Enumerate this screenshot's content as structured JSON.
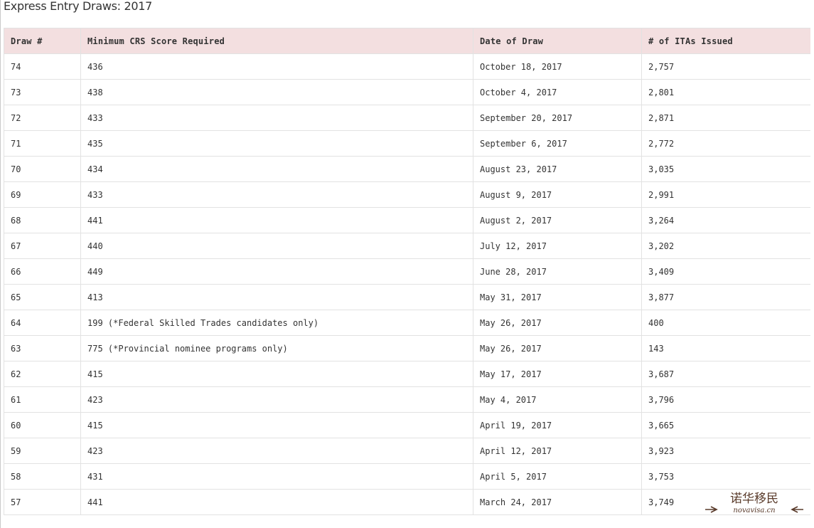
{
  "page": {
    "title": "Express Entry Draws: 2017"
  },
  "table": {
    "headers": [
      "Draw #",
      "Minimum CRS Score Required",
      "Date of Draw",
      "# of ITAs Issued"
    ],
    "rows": [
      [
        "74",
        "436",
        "October 18, 2017",
        "2,757"
      ],
      [
        "73",
        "438",
        "October 4, 2017",
        "2,801"
      ],
      [
        "72",
        "433",
        "September 20, 2017",
        "2,871"
      ],
      [
        "71",
        "435",
        "September 6, 2017",
        "2,772"
      ],
      [
        "70",
        "434",
        "August 23, 2017",
        "3,035"
      ],
      [
        "69",
        "433",
        "August 9, 2017",
        "2,991"
      ],
      [
        "68",
        "441",
        "August 2, 2017",
        "3,264"
      ],
      [
        "67",
        "440",
        "July 12, 2017",
        "3,202"
      ],
      [
        "66",
        "449",
        "June 28, 2017",
        "3,409"
      ],
      [
        "65",
        "413",
        "May 31, 2017",
        "3,877"
      ],
      [
        "64",
        "199 (*Federal Skilled Trades candidates only)",
        "May 26, 2017",
        "400"
      ],
      [
        "63",
        "775 (*Provincial nominee programs only)",
        "May 26, 2017",
        "143"
      ],
      [
        "62",
        "415",
        "May 17, 2017",
        "3,687"
      ],
      [
        "61",
        "423",
        "May 4, 2017",
        "3,796"
      ],
      [
        "60",
        "415",
        "April 19, 2017",
        "3,665"
      ],
      [
        "59",
        "423",
        "April 12, 2017",
        "3,923"
      ],
      [
        "58",
        "431",
        "April 5, 2017",
        "3,753"
      ],
      [
        "57",
        "441",
        "March 24, 2017",
        "3,749"
      ]
    ]
  },
  "watermark": {
    "chinese": "诺华移民",
    "latin": "novavisa.cn"
  },
  "colors": {
    "header_bg": "#f3dfe0",
    "border": "#e2e2e2",
    "text": "#333333",
    "watermark": "#5a3b2b"
  }
}
